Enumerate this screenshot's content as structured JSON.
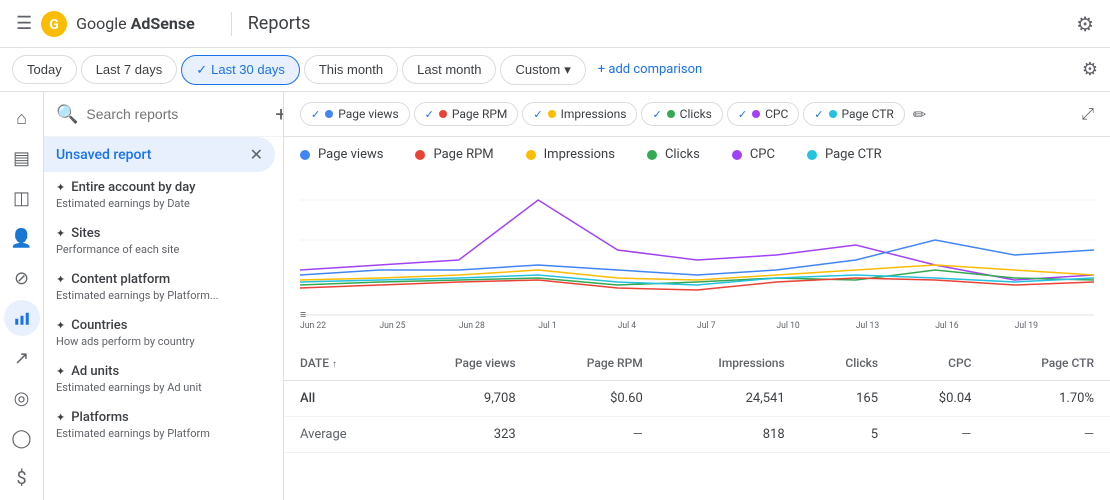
{
  "app": {
    "name": "Google AdSense",
    "logo_letters": "G",
    "section": "Reports"
  },
  "filterbar": {
    "buttons": [
      {
        "label": "Today",
        "active": false
      },
      {
        "label": "Last 7 days",
        "active": false
      },
      {
        "label": "Last 30 days",
        "active": true
      },
      {
        "label": "This month",
        "active": false
      },
      {
        "label": "Last month",
        "active": false
      },
      {
        "label": "Custom",
        "active": false,
        "has_arrow": true
      }
    ],
    "add_comparison": "+ add comparison",
    "settings_label": "Settings"
  },
  "sidebar": {
    "search_placeholder": "Search reports",
    "active_report": "Unsaved report",
    "items": [
      {
        "name": "Entire account by day",
        "desc": "Estimated earnings by Date"
      },
      {
        "name": "Sites",
        "desc": "Performance of each site"
      },
      {
        "name": "Content platform",
        "desc": "Estimated earnings by Platform..."
      },
      {
        "name": "Countries",
        "desc": "How ads perform by country"
      },
      {
        "name": "Ad units",
        "desc": "Estimated earnings by Ad unit"
      },
      {
        "name": "Platforms",
        "desc": "Estimated earnings by Platform"
      }
    ]
  },
  "chart_pills": [
    {
      "label": "Page views",
      "color": "#4285f4",
      "checked": true
    },
    {
      "label": "Page RPM",
      "color": "#ea4335",
      "checked": true
    },
    {
      "label": "Impressions",
      "color": "#fbbc04",
      "checked": true
    },
    {
      "label": "Clicks",
      "color": "#34a853",
      "checked": true
    },
    {
      "label": "CPC",
      "color": "#a142f4",
      "checked": true
    },
    {
      "label": "Page CTR",
      "color": "#24c1e0",
      "checked": true
    }
  ],
  "legend": [
    {
      "label": "Page views",
      "color": "#4285f4"
    },
    {
      "label": "Page RPM",
      "color": "#ea4335"
    },
    {
      "label": "Impressions",
      "color": "#fbbc04"
    },
    {
      "label": "Clicks",
      "color": "#34a853"
    },
    {
      "label": "CPC",
      "color": "#a142f4"
    },
    {
      "label": "Page CTR",
      "color": "#24c1e0"
    }
  ],
  "chart_xaxis": [
    "Jun 22",
    "Jun 25",
    "Jun 28",
    "Jul 1",
    "Jul 4",
    "Jul 7",
    "Jul 10",
    "Jul 13",
    "Jul 16",
    "Jul 19"
  ],
  "table": {
    "headers": [
      "DATE",
      "Page views",
      "Page RPM",
      "Impressions",
      "Clicks",
      "CPC",
      "Page CTR"
    ],
    "rows": [
      {
        "date": "All",
        "page_views": "9,708",
        "page_rpm": "$0.60",
        "impressions": "24,541",
        "clicks": "165",
        "cpc": "$0.04",
        "page_ctr": "1.70%"
      },
      {
        "date": "Average",
        "page_views": "323",
        "page_rpm": "—",
        "impressions": "818",
        "clicks": "5",
        "cpc": "—",
        "page_ctr": "—"
      }
    ]
  },
  "nav_icons": [
    {
      "name": "home",
      "symbol": "⌂",
      "active": false
    },
    {
      "name": "content",
      "symbol": "▤",
      "active": false
    },
    {
      "name": "ads",
      "symbol": "◫",
      "active": false
    },
    {
      "name": "users",
      "symbol": "👤",
      "active": false
    },
    {
      "name": "block",
      "symbol": "⊘",
      "active": false
    },
    {
      "name": "reports",
      "symbol": "📊",
      "active": true
    },
    {
      "name": "insights",
      "symbol": "↗",
      "active": false
    },
    {
      "name": "optimization",
      "symbol": "⚙",
      "active": false
    },
    {
      "name": "account",
      "symbol": "◯",
      "active": false
    },
    {
      "name": "payments",
      "symbol": "💲",
      "active": false
    },
    {
      "name": "settings",
      "symbol": "⚙",
      "active": false
    }
  ]
}
